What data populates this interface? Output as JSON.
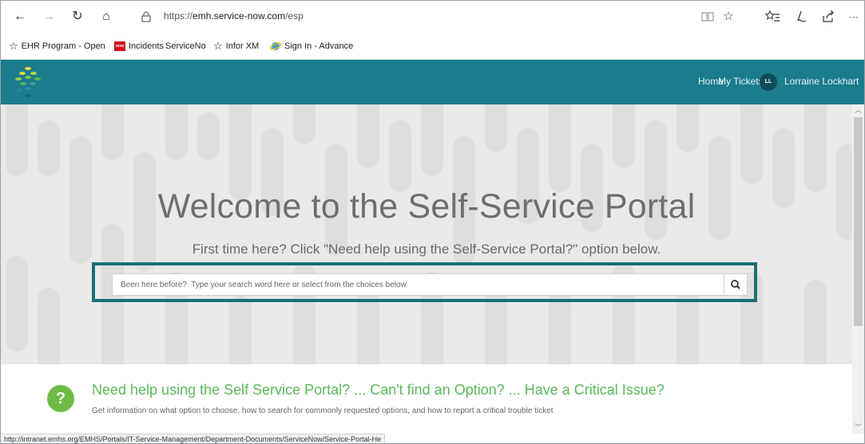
{
  "browser": {
    "url_prefix": "https://",
    "url_domain": "emh.service-now.com",
    "url_path": "/esp",
    "nav": {
      "back": "←",
      "forward": "→",
      "refresh": "↻",
      "home": "⌂"
    },
    "toolbar_icons": [
      "reading-view-icon",
      "favorite-star-icon",
      "favorites-hub-icon",
      "pen-icon",
      "share-icon",
      "more-icon"
    ],
    "more_glyph": "···"
  },
  "favorites": [
    {
      "label": "EHR Program - Open",
      "icon": "star-outline-icon"
    },
    {
      "label": "Incidents",
      "icon": "now-badge-icon",
      "badge": "now"
    },
    {
      "label": "ServiceNo",
      "icon": ""
    },
    {
      "label": "Infor XM",
      "icon": "star-outline-icon"
    },
    {
      "label": "Sign In - Advance",
      "icon": "ie-logo-icon"
    }
  ],
  "header": {
    "links": [
      "Home",
      "My Tickets"
    ],
    "user_initials": "LL",
    "user_name": "Lorraine Lockhart",
    "brand_color": "#1b7c8c"
  },
  "hero": {
    "title": "Welcome to the Self-Service Portal",
    "subtitle": "First time here? Click \"Need help using the Self-Service Portal?\" option below.",
    "search_placeholder": "Been here before?  Type your search word here or select from the choices below",
    "highlight_color": "#1c6f73"
  },
  "help": {
    "icon_glyph": "?",
    "title": "Need help using the Self Service Portal? ... Can't find an Option? ... Have a Critical Issue?",
    "description": "Get information on what option to choose, how to search for commonly requested options, and how to report a critical trouble ticket",
    "accent_color": "#5cb85c"
  },
  "status_bar": {
    "link": "http://intranet.emhs.org/EMHS/Portals/IT-Service-Management/Department-Documents/ServiceNow/Service-Portal-He"
  }
}
